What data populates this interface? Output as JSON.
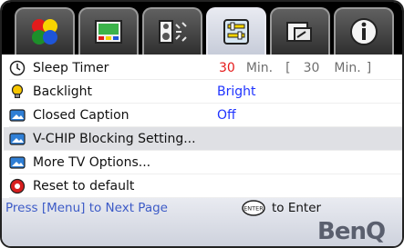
{
  "tabs": [
    {
      "icon": "color-balls-icon",
      "active": false
    },
    {
      "icon": "monitor-picture-icon",
      "active": false
    },
    {
      "icon": "speaker-sound-icon",
      "active": false
    },
    {
      "icon": "settings-panel-icon",
      "active": true
    },
    {
      "icon": "input-source-icon",
      "active": false
    },
    {
      "icon": "info-icon",
      "active": false
    }
  ],
  "menu": {
    "sleep_timer": {
      "label": "Sleep Timer",
      "value": "30",
      "unit": "Min.",
      "bracket_open": "[",
      "alt_value": "30",
      "alt_unit": "Min.",
      "bracket_close": "]"
    },
    "backlight": {
      "label": "Backlight",
      "value": "Bright"
    },
    "closed_caption": {
      "label": "Closed Caption",
      "value": "Off"
    },
    "vchip": {
      "label": "V-CHIP Blocking Setting..."
    },
    "more_tv": {
      "label": "More TV Options..."
    },
    "reset": {
      "label": "Reset to default"
    }
  },
  "footer": {
    "hint": "Press [Menu] to Next Page",
    "enter_icon_text": "ENTER",
    "enter_label": "to Enter",
    "logo": "BenQ"
  },
  "colors": {
    "value_blue": "#1f33ff",
    "sleep_red": "#e51a1a",
    "hint_blue": "#3d5bc7"
  }
}
